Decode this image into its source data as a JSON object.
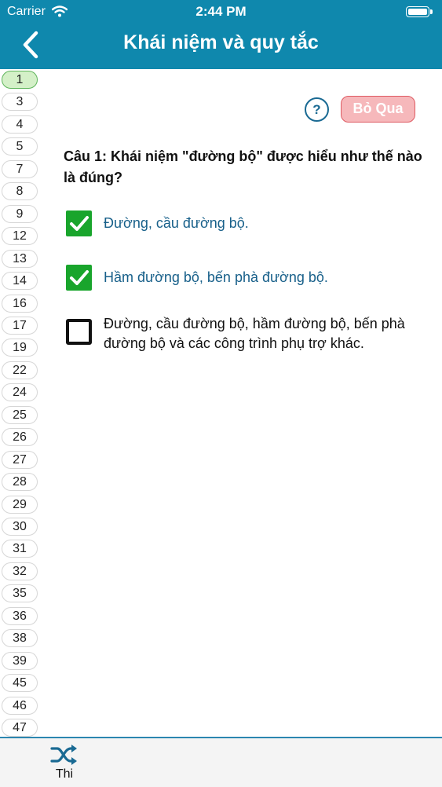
{
  "status_bar": {
    "carrier": "Carrier",
    "time": "2:44 PM"
  },
  "header": {
    "title": "Khái niệm và quy tắc"
  },
  "question_numbers": [
    "1",
    "3",
    "4",
    "5",
    "7",
    "8",
    "9",
    "12",
    "13",
    "14",
    "16",
    "17",
    "19",
    "22",
    "24",
    "25",
    "26",
    "27",
    "28",
    "29",
    "30",
    "31",
    "32",
    "35",
    "36",
    "38",
    "39",
    "45",
    "46",
    "47"
  ],
  "active_question": "1",
  "toolbar": {
    "help_label": "?",
    "skip_label": "Bỏ Qua"
  },
  "question": {
    "text": "Câu 1: Khái niệm \"đường bộ\" được hiểu như thế nào là đúng?",
    "answers": [
      {
        "text": "Đường, cầu đường bộ.",
        "checked": true
      },
      {
        "text": "Hầm đường bộ, bến phà đường bộ.",
        "checked": true
      },
      {
        "text": "Đường, cầu đường bộ, hầm đường bộ, bến phà đường bộ và các công trình phụ trợ khác.",
        "checked": false
      }
    ]
  },
  "tab_bar": {
    "items": [
      {
        "label": "Thi",
        "icon": "shuffle-icon"
      }
    ]
  },
  "colors": {
    "header": "#0f88ad",
    "checkbox_checked": "#19a52c",
    "selected_text": "#18608a",
    "skip_button": "#f6b8bb"
  }
}
